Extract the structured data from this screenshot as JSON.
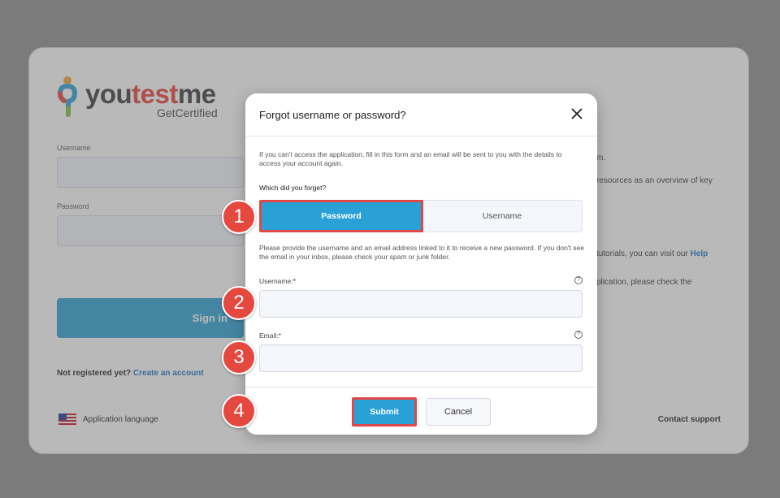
{
  "background": {
    "logo": {
      "word_part1": "you",
      "word_part2": "test",
      "word_part3": "me",
      "tagline": "GetCertified"
    },
    "username_label": "Username",
    "password_label": "Password",
    "signin_label": "Sign in",
    "not_registered": "Not registered yet?",
    "create_account": "Create an account",
    "app_language": "Application language",
    "contact_support": "Contact support",
    "right_fragments": [
      "m.",
      "resources as an overview of key",
      "tutorials, you can visit our",
      "Help",
      "plication, please check the"
    ]
  },
  "modal": {
    "title": "Forgot username or password?",
    "intro": "If you can't access the application, fill in this form and an email will be sent to you with the details to access your account again.",
    "which_label": "Which did you forget?",
    "options": [
      {
        "label": "Password",
        "active": true
      },
      {
        "label": "Username",
        "active": false
      }
    ],
    "provide_text": "Please provide the username and an email address linked to it to receive a new password. If you don't see the email in your inbox, please check your spam or junk folder.",
    "username_label": "Username:*",
    "username_value": "",
    "email_label": "Email:*",
    "email_value": "",
    "help_glyph": "?",
    "submit_label": "Submit",
    "cancel_label": "Cancel"
  },
  "badges": [
    "1",
    "2",
    "3",
    "4"
  ],
  "colors": {
    "accent": "#2aa1d6",
    "highlight": "#e04848",
    "badge": "#e5483f"
  }
}
